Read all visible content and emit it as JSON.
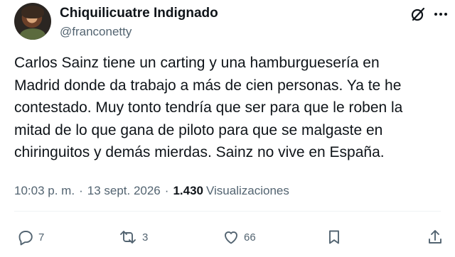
{
  "author": {
    "display_name": "Chiquilicuatre Indignado",
    "handle": "@franconetty"
  },
  "tweet": {
    "text": "Carlos Sainz tiene un carting y una hamburguesería en\nMadrid donde da trabajo a más de cien personas. Ya te he\ncontestado. Muy tonto tendría que ser para que le roben la\nmitad de lo que gana de piloto para que se malgaste en\nchiringuitos y demás mierdas. Sainz no vive en España."
  },
  "meta": {
    "time": "10:03 p. m.",
    "separator": "·",
    "date": "13 sept. 2026",
    "views_count": "1.430",
    "views_label": "Visualizaciones"
  },
  "actions": {
    "reply_count": "7",
    "retweet_count": "3",
    "like_count": "66"
  },
  "icons": {
    "grok": "grok-icon",
    "more": "more-icon",
    "reply": "reply-icon",
    "retweet": "retweet-icon",
    "like": "heart-icon",
    "bookmark": "bookmark-icon",
    "share": "share-icon"
  },
  "colors": {
    "text_primary": "#0f1419",
    "text_secondary": "#536471",
    "divider": "#eff3f4"
  }
}
